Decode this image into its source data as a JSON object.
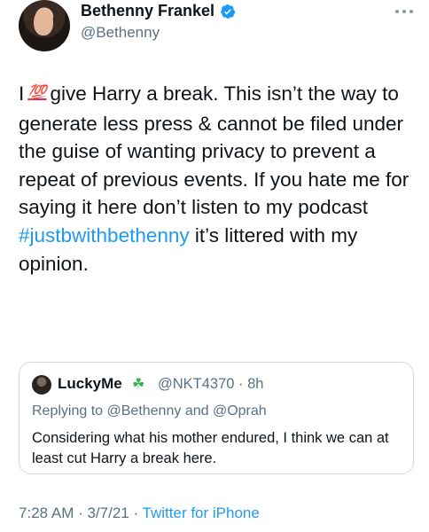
{
  "author": {
    "name": "Bethenny Frankel",
    "handle": "@Bethenny",
    "verified": true
  },
  "tweet": {
    "text_part1": "I",
    "emoji": "💯",
    "text_part2": "give Harry a break.  This isn’t the way to generate less press & cannot be filed under the guise of wanting privacy to prevent a repeat of previous events. If you hate me for saying it here don’t listen to my podcast",
    "hashtag": "#justbwithbethenny",
    "text_part3": "it’s littered with my opinion."
  },
  "quoted": {
    "name": "LuckyMe",
    "name_emoji": "☘",
    "handle_time": "@NKT4370 · 8h",
    "replying_prefix": "Replying to",
    "mention1": "@Bethenny",
    "and": "and",
    "mention2": "@Oprah",
    "text": "Considering what his mother endured, I think we can at least cut Harry a break here."
  },
  "footer": {
    "time_date": "7:28 AM · 3/7/21 · ",
    "source": "Twitter for iPhone"
  },
  "colors": {
    "link": "#1d9bf0",
    "secondary": "#5b7083",
    "text": "#0f1419"
  },
  "icons": {
    "verified": "verified-badge-icon",
    "more": "more-options-icon"
  }
}
